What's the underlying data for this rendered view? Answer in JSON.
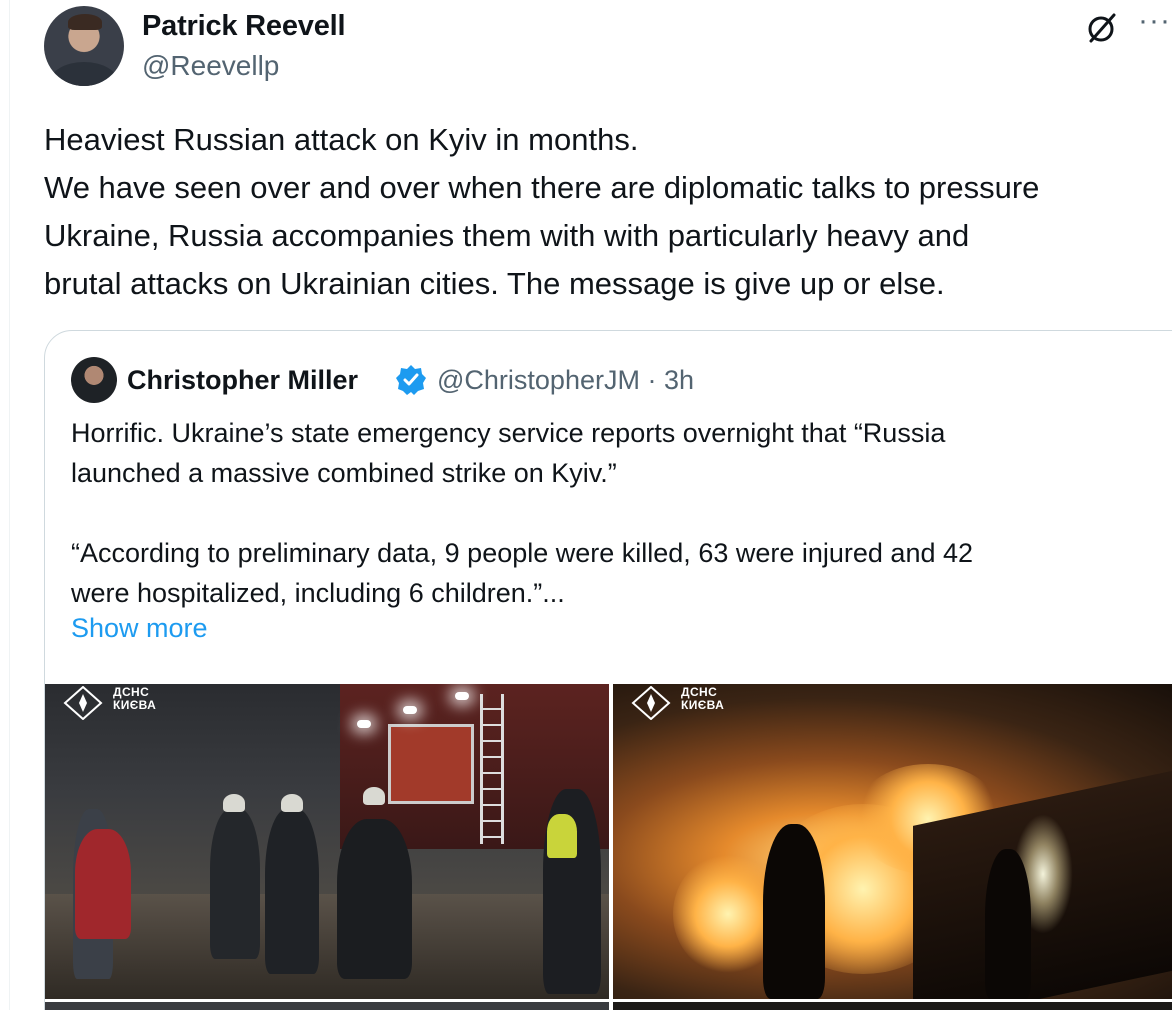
{
  "author": {
    "name": "Patrick Reevell",
    "handle": "@Reevellp"
  },
  "header_icons": {
    "grok": "grok-icon",
    "more": "more-icon",
    "more_glyph": "···"
  },
  "tweet": {
    "lines": [
      "Heaviest Russian attack on Kyiv in months.",
      "We have seen over and over when there are diplomatic talks to pressure",
      "Ukraine, Russia accompanies them with with particularly heavy and",
      "brutal attacks on Ukrainian cities. The message is give up or else."
    ]
  },
  "quote": {
    "name": "Christopher Miller",
    "handle_time": "@ChristopherJM · 3h",
    "verified": true,
    "lines": [
      "Horrific. Ukraine’s state emergency service reports overnight that “Russia",
      "launched a massive combined strike on Kyiv.”",
      "",
      "“According to preliminary data, 9 people were killed, 63 were injured and 42",
      "were hospitalized, including 6 children.”..."
    ],
    "show_more": "Show more",
    "photo_badge_line1": "ДСНС",
    "photo_badge_line2": "КИЄВА"
  },
  "colors": {
    "text": "#0f1419",
    "secondary": "#536471",
    "link": "#1d9bf0",
    "border": "#cfd9de"
  }
}
